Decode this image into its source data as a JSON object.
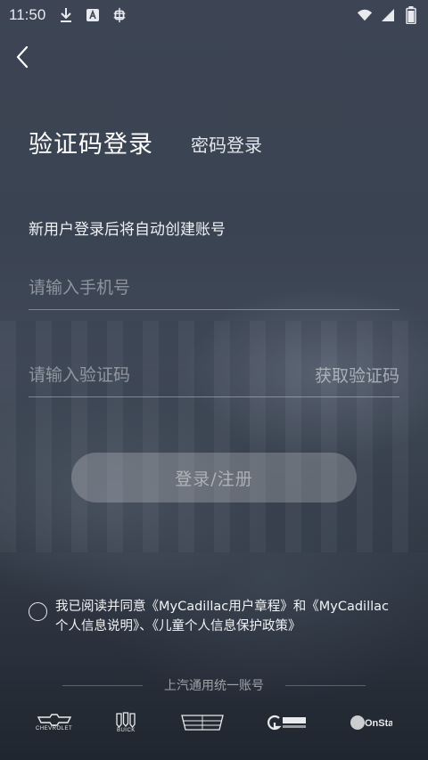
{
  "status_bar": {
    "time": "11:50",
    "left_icons": [
      "download-icon",
      "a-app-icon",
      "bug-app-icon"
    ],
    "right_icons": [
      "wifi-icon",
      "signal-icon",
      "battery-icon"
    ]
  },
  "back_icon": "chevron-left-icon",
  "tabs": {
    "active_label": "验证码登录",
    "inactive_label": "密码登录"
  },
  "hint": "新用户登录后将自动创建账号",
  "phone_field": {
    "placeholder": "请输入手机号",
    "value": ""
  },
  "code_field": {
    "placeholder": "请输入验证码",
    "value": ""
  },
  "get_code_label": "获取验证码",
  "login_label": "登录/注册",
  "agreement": {
    "line1": "我已阅读并同意《MyCadillac用户章程》和《MyCadillac",
    "line2": "个人信息说明》、《儿童个人信息保护政策》",
    "checked": false
  },
  "divider_label": "上汽通用统一账号",
  "brands": [
    {
      "icon": "chevrolet-logo-icon",
      "text": "CHEVROLET"
    },
    {
      "icon": "buick-logo-icon",
      "text": "BUICK"
    },
    {
      "icon": "cadillac-logo-icon",
      "text": ""
    },
    {
      "icon": "partner-logo-icon",
      "text": ""
    },
    {
      "icon": "onstar-logo-icon",
      "text": "OnStar"
    }
  ],
  "colors": {
    "background": "#3a4250",
    "text": "#ffffff",
    "button_bg": "rgba(255,255,255,0.22)",
    "placeholder": "rgba(255,255,255,0.42)"
  }
}
